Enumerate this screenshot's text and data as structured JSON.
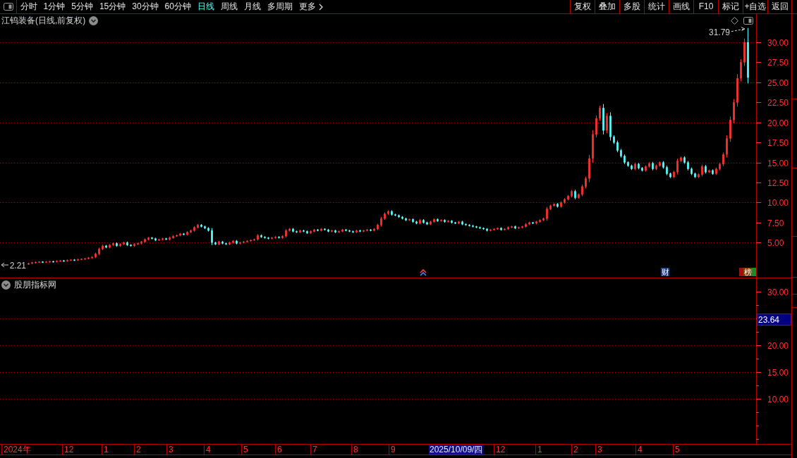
{
  "toolbar": {
    "periods": [
      {
        "label": "分时",
        "selected": false
      },
      {
        "label": "1分钟",
        "selected": false
      },
      {
        "label": "5分钟",
        "selected": false
      },
      {
        "label": "15分钟",
        "selected": false
      },
      {
        "label": "30分钟",
        "selected": false
      },
      {
        "label": "60分钟",
        "selected": false
      },
      {
        "label": "日线",
        "selected": true
      },
      {
        "label": "周线",
        "selected": false
      },
      {
        "label": "月线",
        "selected": false
      },
      {
        "label": "多周期",
        "selected": false
      }
    ],
    "more": {
      "label": "更多"
    },
    "actions": [
      "复权",
      "叠加",
      "多股",
      "统计",
      "画线",
      "F10",
      "标记",
      "+自选",
      "返回"
    ]
  },
  "main_chart": {
    "title": "江钨装备(日线,前复权)",
    "price_axis": [
      "30.00",
      "27.50",
      "25.00",
      "22.50",
      "20.00",
      "17.50",
      "15.00",
      "12.50",
      "10.00",
      "7.50",
      "5.00"
    ],
    "high_label": "31.79",
    "low_label": "2.21",
    "event_tags": [
      {
        "label": "财",
        "color": "#1c3c88"
      },
      {
        "label": "榜",
        "color": "#82420e"
      }
    ],
    "side_markers": [
      {
        "color": "#a01010"
      },
      {
        "color": "#1a8a2a"
      }
    ]
  },
  "indicator_panel": {
    "title": "股朋指标网",
    "value_axis": [
      {
        "kind": "tick",
        "label": "30.00"
      },
      {
        "kind": "current",
        "label": "23.64"
      },
      {
        "kind": "tick",
        "label": "20.00"
      },
      {
        "kind": "tick",
        "label": "15.00"
      },
      {
        "kind": "tick",
        "label": "10.00"
      }
    ]
  },
  "date_axis": {
    "labels": [
      "2024年",
      "12",
      "1",
      "2",
      "3",
      "4",
      "5",
      "6",
      "7",
      "8",
      "9",
      "12",
      "1",
      "2",
      "3",
      "4",
      "5"
    ],
    "cursor": "2025/10/09/四"
  }
}
